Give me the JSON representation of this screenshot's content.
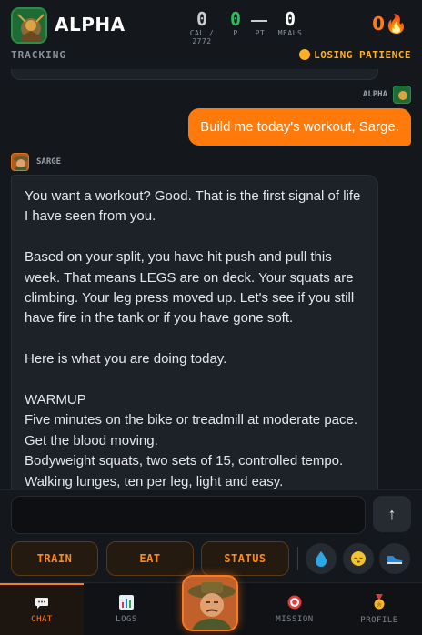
{
  "header": {
    "app_name": "ALPHA",
    "stats": {
      "cal_value": "0",
      "cal_label": "CAL / 2772",
      "p_value": "0",
      "p_label": "P",
      "pt_label": "PT",
      "meals_value": "0",
      "meals_label": "MEALS"
    },
    "streak": "0🔥",
    "tracking_label": "TRACKING",
    "mood_label": "LOSING PATIENCE"
  },
  "chat": {
    "user_name": "ALPHA",
    "user_message": "Build me today's workout, Sarge.",
    "sarge_name": "SARGE",
    "sarge_paragraphs": [
      "You want a workout? Good. That is the first signal of life I have seen from you.",
      "Based on your split, you have hit push and pull this week. That means LEGS are on deck. Your squats are climbing. Your leg press moved up. Let's see if you still have fire in the tank or if you have gone soft.",
      "Here is what you are doing today."
    ],
    "sarge_lines": [
      "WARMUP",
      "Five minutes on the bike or treadmill at moderate pace. Get the blood moving.",
      "Bodyweight squats, two sets of 15, controlled tempo.",
      "Walking lunges, ten per leg, light and easy."
    ]
  },
  "composer": {
    "send_icon": "↑",
    "quick_actions": [
      "TRAIN",
      "EAT",
      "STATUS"
    ],
    "icons": [
      "water-drop-icon",
      "sleep-face-icon",
      "shoe-icon"
    ]
  },
  "nav": {
    "items": [
      {
        "label": "CHAT",
        "icon": "chat-bubble-icon"
      },
      {
        "label": "LOGS",
        "icon": "bar-chart-icon"
      },
      {
        "label": "MISSION",
        "icon": "target-icon"
      },
      {
        "label": "PROFILE",
        "icon": "medal-icon"
      }
    ]
  },
  "colors": {
    "accent": "#ff7a1a",
    "protein_green": "#26c15b",
    "mood_yellow": "#ffb020",
    "background": "#14171c"
  }
}
